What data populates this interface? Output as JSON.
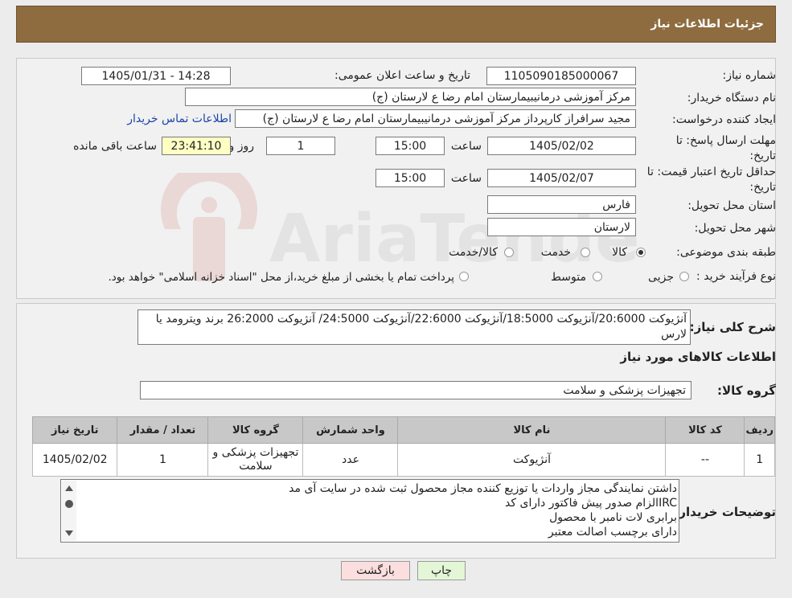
{
  "header": {
    "title": "جزئیات اطلاعات نیاز"
  },
  "watermark": {
    "text": "AriaTender.neT"
  },
  "form": {
    "need_number_label": "شماره نیاز:",
    "need_number": "1105090185000067",
    "announce_label": "تاریخ و ساعت اعلان عمومی:",
    "announce_value": "1405/01/31 - 14:28",
    "buyer_org_label": "نام دستگاه خریدار:",
    "buyer_org": "مرکز آموزشی درمانیبیمارستان امام رضا  ع  لارستان (ج)",
    "creator_label": "ایجاد کننده درخواست:",
    "creator": "مجید سرافراز کارپرداز  مرکز آموزشی درمانیبیمارستان امام رضا  ع  لارستان (ج)",
    "contact_link": "اطلاعات تماس خریدار",
    "deadline_label": "مهلت ارسال پاسخ: تا تاریخ:",
    "deadline_date": "1405/02/02",
    "time_label": "ساعت",
    "deadline_time": "15:00",
    "days_value": "1",
    "days_label": "روز و",
    "remaining_value": "23:41:10",
    "remaining_label": "ساعت باقی مانده",
    "validity_label": "حداقل تاریخ اعتبار قیمت: تا تاریخ:",
    "validity_date": "1405/02/07",
    "validity_time": "15:00",
    "province_label": "استان محل تحویل:",
    "province": "فارس",
    "city_label": "شهر محل تحویل:",
    "city": "لارستان",
    "category_label": "طبقه بندی موضوعی:",
    "category_options": [
      "کالا",
      "خدمت",
      "کالا/خدمت"
    ],
    "category_selected": "کالا",
    "process_label": "نوع فرآیند خرید :",
    "process_options": [
      "جزیی",
      "متوسط"
    ],
    "process_note": "پرداخت تمام یا بخشی از مبلغ خرید،از محل \"اسناد خزانه اسلامی\" خواهد بود."
  },
  "summary": {
    "label": "شرح کلی نیاز:",
    "text": "آنژیوکت 20:6000/آنژیوکت 18:5000/آنژیوکت 22:6000/آنژیوکت 24:5000/ آنژیوکت 26:2000 برند ویترومد یا لارس"
  },
  "goods": {
    "section_title": "اطلاعات کالاهای مورد نیاز",
    "group_label": "گروه کالا:",
    "group_value": "تجهیزات پزشکی و سلامت",
    "columns": [
      "ردیف",
      "کد کالا",
      "نام کالا",
      "واحد شمارش",
      "گروه کالا",
      "تعداد / مقدار",
      "تاریخ نیاز"
    ],
    "rows": [
      [
        "1",
        "--",
        "آنژیوکت",
        "عدد",
        "تجهیزات پزشکی و سلامت",
        "1",
        "1405/02/02"
      ]
    ]
  },
  "buyer_notes": {
    "label": "توضیحات خریدار:",
    "lines": [
      "داشتن نمایندگی مجاز واردات یا توزیع کننده مجاز محصول ثبت شده در سایت آی مد",
      "IRCالزام صدور پیش فاکتور دارای کد",
      "برابری لات نامبر با محصول",
      "دارای برچسب اصالت معتبر"
    ]
  },
  "buttons": {
    "print": "چاپ",
    "back": "بازگشت"
  },
  "colors": {
    "header": "#8e6c3f",
    "highlight": "#ffffc4",
    "back_button": "#fbdede",
    "print_button": "#e3f7d7"
  }
}
